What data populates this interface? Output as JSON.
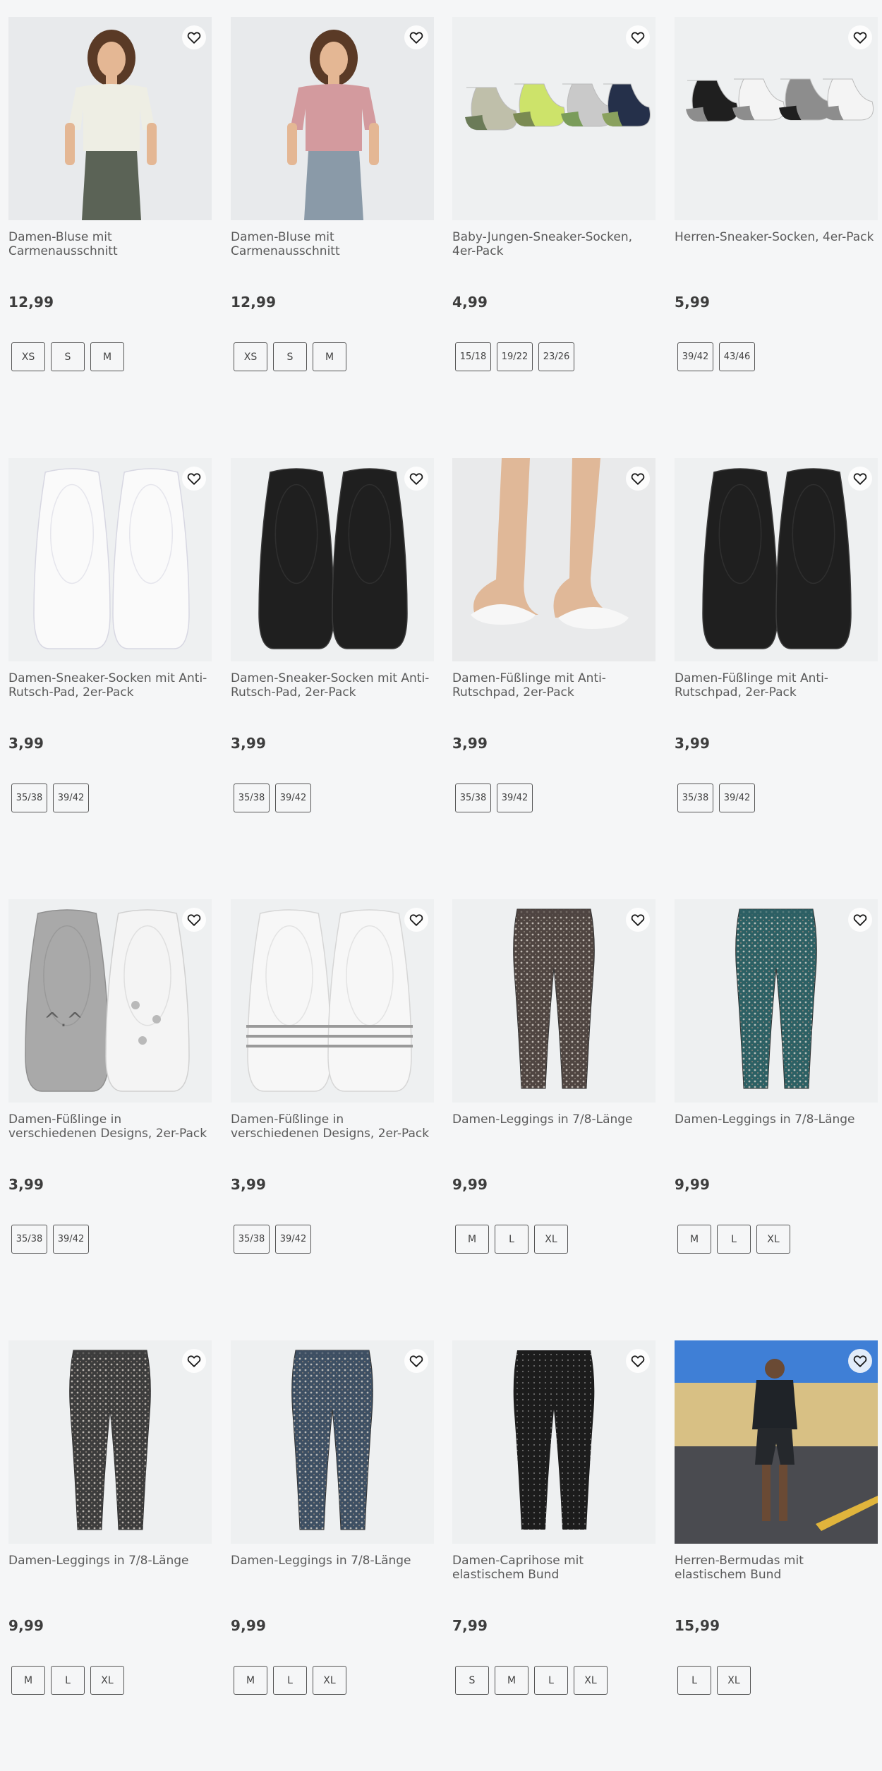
{
  "products": [
    {
      "name": "Damen-Bluse mit Carmenausschnitt",
      "price": "12,99",
      "sizes": [
        "XS",
        "S",
        "M"
      ],
      "image": "woman-white-blouse"
    },
    {
      "name": "Damen-Bluse mit Carmenausschnitt",
      "price": "12,99",
      "sizes": [
        "XS",
        "S",
        "M"
      ],
      "image": "woman-pink-blouse"
    },
    {
      "name": "Baby-Jungen-Sneaker-Socken, 4er-Pack",
      "price": "4,99",
      "sizes": [
        "15/18",
        "19/22",
        "23/26"
      ],
      "image": "baby-socks"
    },
    {
      "name": "Herren-Sneaker-Socken, 4er-Pack",
      "price": "5,99",
      "sizes": [
        "39/42",
        "43/46"
      ],
      "image": "men-socks"
    },
    {
      "name": "Damen-Sneaker-Socken mit Anti-Rutsch-Pad, 2er-Pack",
      "price": "3,99",
      "sizes": [
        "35/38",
        "39/42"
      ],
      "image": "white-footies"
    },
    {
      "name": "Damen-Sneaker-Socken mit Anti-Rutsch-Pad, 2er-Pack",
      "price": "3,99",
      "sizes": [
        "35/38",
        "39/42"
      ],
      "image": "black-footies"
    },
    {
      "name": "Damen-Füßlinge mit Anti-Rutschpad, 2er-Pack",
      "price": "3,99",
      "sizes": [
        "35/38",
        "39/42"
      ],
      "image": "feet-footies"
    },
    {
      "name": "Damen-Füßlinge mit Anti-Rutschpad, 2er-Pack",
      "price": "3,99",
      "sizes": [
        "35/38",
        "39/42"
      ],
      "image": "black-footies"
    },
    {
      "name": "Damen-Füßlinge in verschiedenen Designs, 2er-Pack",
      "price": "3,99",
      "sizes": [
        "35/38",
        "39/42"
      ],
      "image": "cat-footies"
    },
    {
      "name": "Damen-Füßlinge in verschiedenen Designs, 2er-Pack",
      "price": "3,99",
      "sizes": [
        "35/38",
        "39/42"
      ],
      "image": "striped-footies"
    },
    {
      "name": "Damen-Leggings in 7/8-Länge",
      "price": "9,99",
      "sizes": [
        "M",
        "L",
        "XL"
      ],
      "image": "leggings-brown"
    },
    {
      "name": "Damen-Leggings in 7/8-Länge",
      "price": "9,99",
      "sizes": [
        "M",
        "L",
        "XL"
      ],
      "image": "leggings-teal"
    },
    {
      "name": "Damen-Leggings in 7/8-Länge",
      "price": "9,99",
      "sizes": [
        "M",
        "L",
        "XL"
      ],
      "image": "leggings-grey"
    },
    {
      "name": "Damen-Leggings in 7/8-Länge",
      "price": "9,99",
      "sizes": [
        "M",
        "L",
        "XL"
      ],
      "image": "leggings-blue"
    },
    {
      "name": "Damen-Caprihose mit elastischem Bund",
      "price": "7,99",
      "sizes": [
        "S",
        "M",
        "L",
        "XL"
      ],
      "image": "capri-black"
    },
    {
      "name": "Herren-Bermudas mit elastischem Bund",
      "price": "15,99",
      "sizes": [
        "L",
        "XL"
      ],
      "image": "man-bermudas"
    }
  ],
  "colors": {
    "background": "#f5f6f7",
    "image_bg": "#eef0f1",
    "text": "#5a5a5a",
    "price": "#3d3d3d",
    "size_border": "#555555"
  },
  "icons": {
    "favorite": "heart-outline-icon"
  }
}
